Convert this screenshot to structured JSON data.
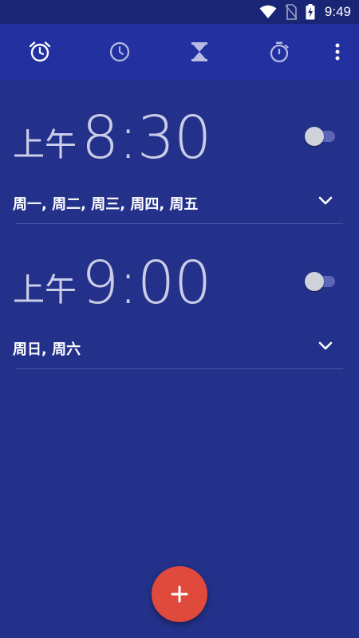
{
  "status_bar": {
    "time": "9:49",
    "icons": [
      "wifi-icon",
      "no-sim-icon",
      "battery-charging-icon"
    ]
  },
  "toolbar": {
    "tabs": [
      {
        "name": "alarm",
        "icon": "alarm-clock-icon",
        "selected": true
      },
      {
        "name": "clock",
        "icon": "clock-icon",
        "selected": false
      },
      {
        "name": "timer",
        "icon": "hourglass-icon",
        "selected": false
      },
      {
        "name": "stopwatch",
        "icon": "stopwatch-icon",
        "selected": false
      }
    ],
    "overflow_icon": "more-vert-icon"
  },
  "alarms": [
    {
      "ampm": "上午",
      "time": "8:30",
      "days": "周一, 周二, 周三, 周四, 周五",
      "enabled": false
    },
    {
      "ampm": "上午",
      "time": "9:00",
      "days": "周日, 周六",
      "enabled": false
    }
  ],
  "fab": {
    "label": "+",
    "icon": "add-icon"
  },
  "colors": {
    "background": "#24318b",
    "toolbar": "#2330a0",
    "status_bar": "#1a2575",
    "accent": "#e04a3c",
    "time_text": "#c9cde8"
  }
}
